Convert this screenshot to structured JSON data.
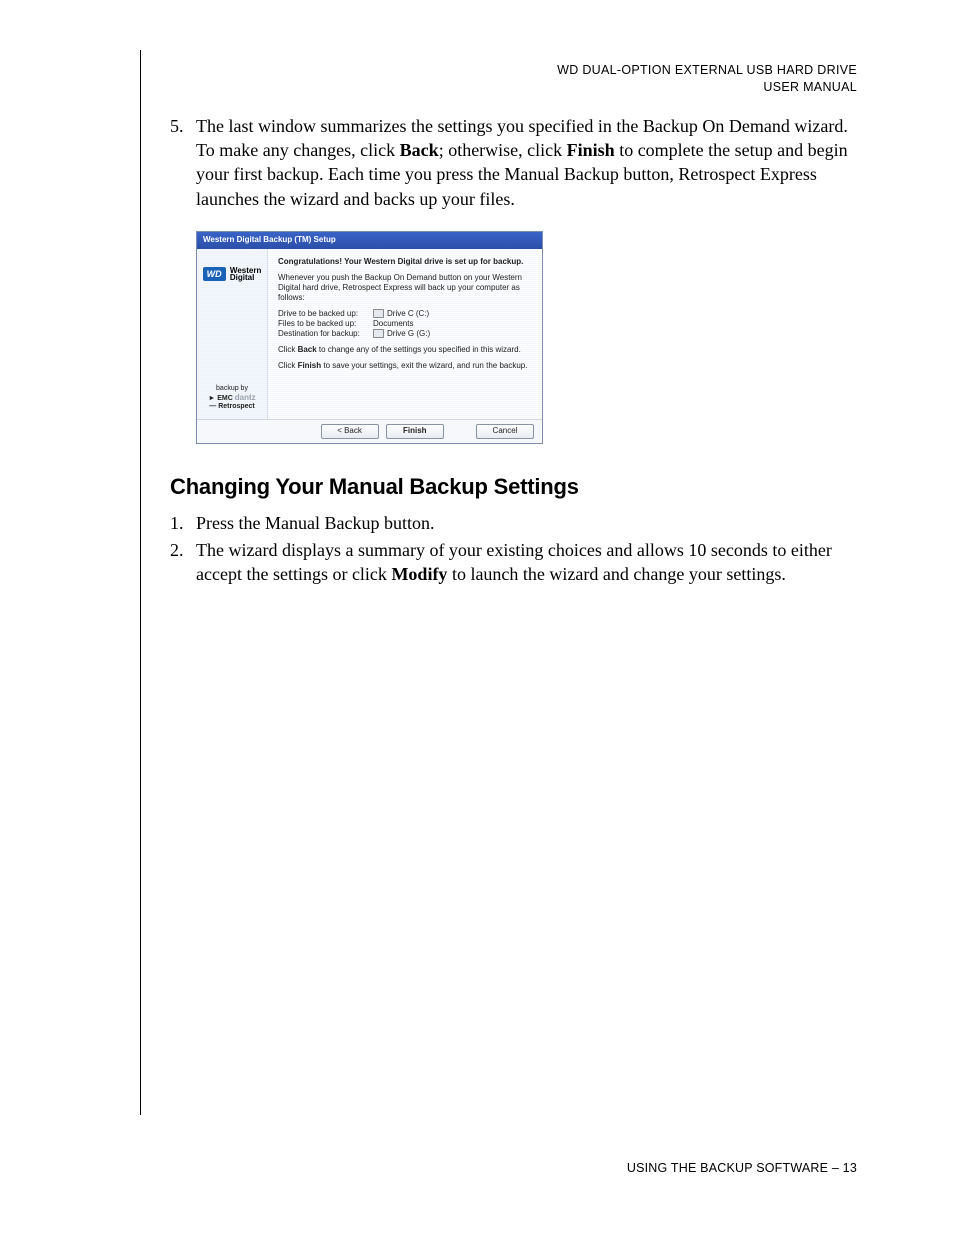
{
  "header": {
    "line1": "WD DUAL-OPTION EXTERNAL USB HARD DRIVE",
    "line2": "USER MANUAL"
  },
  "step5": {
    "num": "5.",
    "part1": "The last window summarizes the settings you specified in the Backup On Demand wizard. To make any changes, click ",
    "bold1": "Back",
    "part2": "; otherwise, click ",
    "bold2": "Finish",
    "part3": " to complete the setup and begin your first backup. Each time you press the Manual Backup button, Retrospect Express launches the wizard and backs up your files."
  },
  "wizard": {
    "title": "Western Digital Backup (TM) Setup",
    "logo_brand": "WD",
    "logo_text1": "Western",
    "logo_text2": "Digital",
    "left_backupby": "backup by",
    "left_emc": "EMC",
    "left_dantz": "dantz",
    "left_retro": "Retrospect",
    "congrats": "Congratulations! Your Western Digital drive is set up for backup.",
    "intro": "Whenever you push the Backup On Demand button on your Western Digital hard drive, Retrospect Express will back up your computer as follows:",
    "rows": [
      {
        "k": "Drive to be backed up:",
        "v": "Drive C (C:)",
        "icon": true
      },
      {
        "k": "Files to be backed up:",
        "v": "Documents",
        "icon": false
      },
      {
        "k": "Destination for backup:",
        "v": "Drive G (G:)",
        "icon": true
      }
    ],
    "line_back_a": "Click ",
    "line_back_b": "Back",
    "line_back_c": " to change any of the settings you specified in this wizard.",
    "line_finish_a": "Click ",
    "line_finish_b": "Finish",
    "line_finish_c": " to save your settings, exit the wizard, and run the backup.",
    "btn_back": "< Back",
    "btn_finish": "Finish",
    "btn_cancel": "Cancel"
  },
  "section_heading": "Changing Your Manual Backup Settings",
  "step_c1": {
    "num": "1.",
    "text": "Press the Manual Backup button."
  },
  "step_c2": {
    "num": "2.",
    "part1": "The wizard displays a summary of your existing choices and allows 10 seconds to either accept the settings or click ",
    "bold1": "Modify",
    "part2": " to launch the wizard and change your settings."
  },
  "footer": "USING THE BACKUP SOFTWARE – 13"
}
